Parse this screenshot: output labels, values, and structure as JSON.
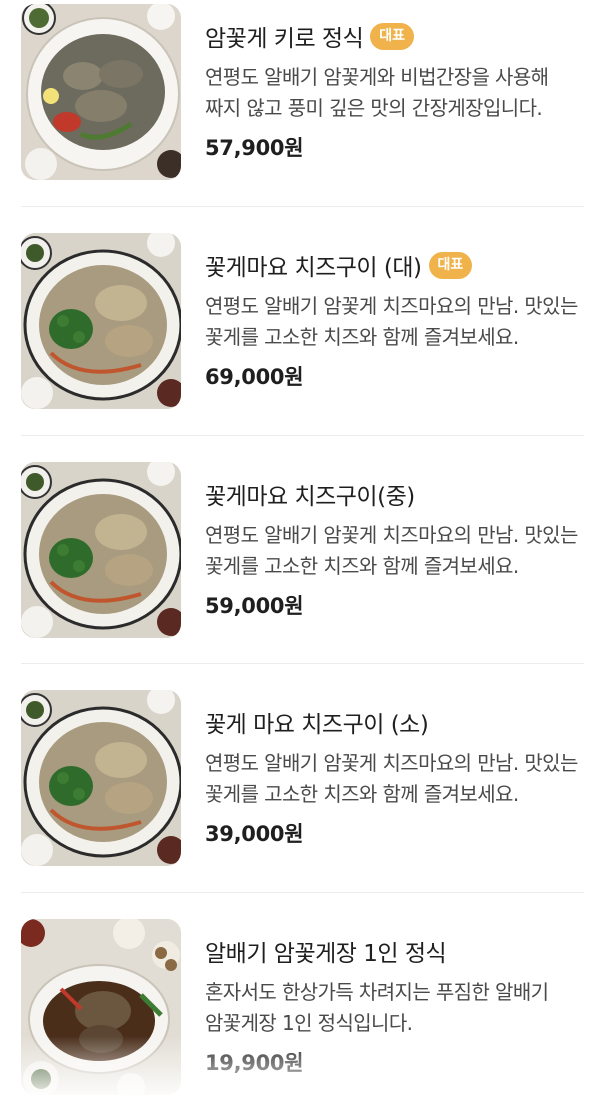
{
  "menu": {
    "items": [
      {
        "name": "암꽃게 키로 정식",
        "badge": "대표",
        "description": "연평도 알배기 암꽃게와 비법간장을 사용해 짜지 않고 풍미 깊은 맛의 간장게장입니다.",
        "price": "57,900원"
      },
      {
        "name": "꽃게마요 치즈구이 (대)",
        "badge": "대표",
        "description": "연평도 알배기 암꽃게 치즈마요의 만남. 맛있는 꽃게를 고소한 치즈와 함께 즐겨보세요.",
        "price": "69,000원"
      },
      {
        "name": "꽃게마요 치즈구이(중)",
        "badge": "",
        "description": "연평도 알배기 암꽃게 치즈마요의 만남. 맛있는 꽃게를 고소한 치즈와 함께 즐겨보세요.",
        "price": "59,000원"
      },
      {
        "name": "꽃게 마요 치즈구이 (소)",
        "badge": "",
        "description": "연평도 알배기 암꽃게 치즈마요의 만남. 맛있는 꽃게를 고소한 치즈와 함께 즐겨보세요.",
        "price": "39,000원"
      },
      {
        "name": "알배기 암꽃게장 1인 정식",
        "badge": "",
        "description": "혼자서도 한상가득 차려지는 푸짐한 알배기 암꽃게장 1인 정식입니다.",
        "price": "19,900원"
      }
    ]
  },
  "colors": {
    "badge": "#f0b24a",
    "divider": "#ececec",
    "text": "#1f1f1f",
    "subtext": "#4a4a4a"
  }
}
